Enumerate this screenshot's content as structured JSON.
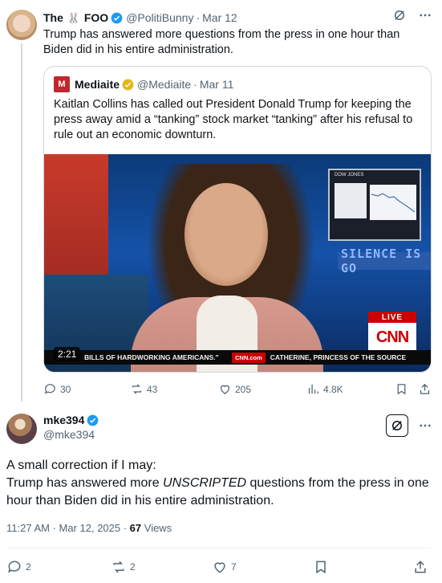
{
  "tweet1": {
    "name_prefix": "The",
    "name_emoji": "🐰",
    "name_suffix": "FOO",
    "handle": "@PolitiBunny",
    "separator": "·",
    "date": "Mar 12",
    "text": "Trump has answered more questions from the press in one hour than Biden did in his entire administration."
  },
  "quote": {
    "logo_letter": "M",
    "name": "Mediaite",
    "handle": "@Mediaite",
    "separator": "·",
    "date": "Mar 11",
    "text": "Kaitlan Collins has called out President Donald Trump for keeping the press away amid a “tanking”  stock market “tanking” after his refusal to rule out an economic downturn.",
    "video": {
      "duration": "2:21",
      "live_label": "LIVE",
      "network_logo": "CNN",
      "monitor_label": "DOW JONES",
      "background_text": "SILENCE IS GO",
      "ticker_left": "BILLS OF HARDWORKING AMERICANS.\"",
      "ticker_site": "CNN.com",
      "ticker_right": "CATHERINE, PRINCESS OF THE SOURCE"
    }
  },
  "tweet1_actions": {
    "replies": "30",
    "reposts": "43",
    "likes": "205",
    "views": "4.8K"
  },
  "tweet2": {
    "name": "mke394",
    "handle": "@mke394",
    "text_line1": "A small correction if I may:",
    "text_before": "Trump has answered more ",
    "text_emphasis": "UNSCRIPTED",
    "text_after": " questions from the press in one hour than Biden did in his entire administration.",
    "time": "11:27 AM · Mar 12, 2025 · ",
    "views_count": "67",
    "views_label": " Views",
    "replies": "2",
    "reposts": "2",
    "likes": "7"
  },
  "colors": {
    "text": "#0f1419",
    "secondary": "#536471",
    "verified": "#1d9bf0",
    "gold_verified": "#e2b719",
    "border": "#cfd9de",
    "cnn_red": "#cc0000"
  },
  "icons": [
    "grok-icon",
    "more-icon",
    "reply-icon",
    "repost-icon",
    "like-icon",
    "views-icon",
    "bookmark-icon",
    "share-icon",
    "verified-icon"
  ]
}
